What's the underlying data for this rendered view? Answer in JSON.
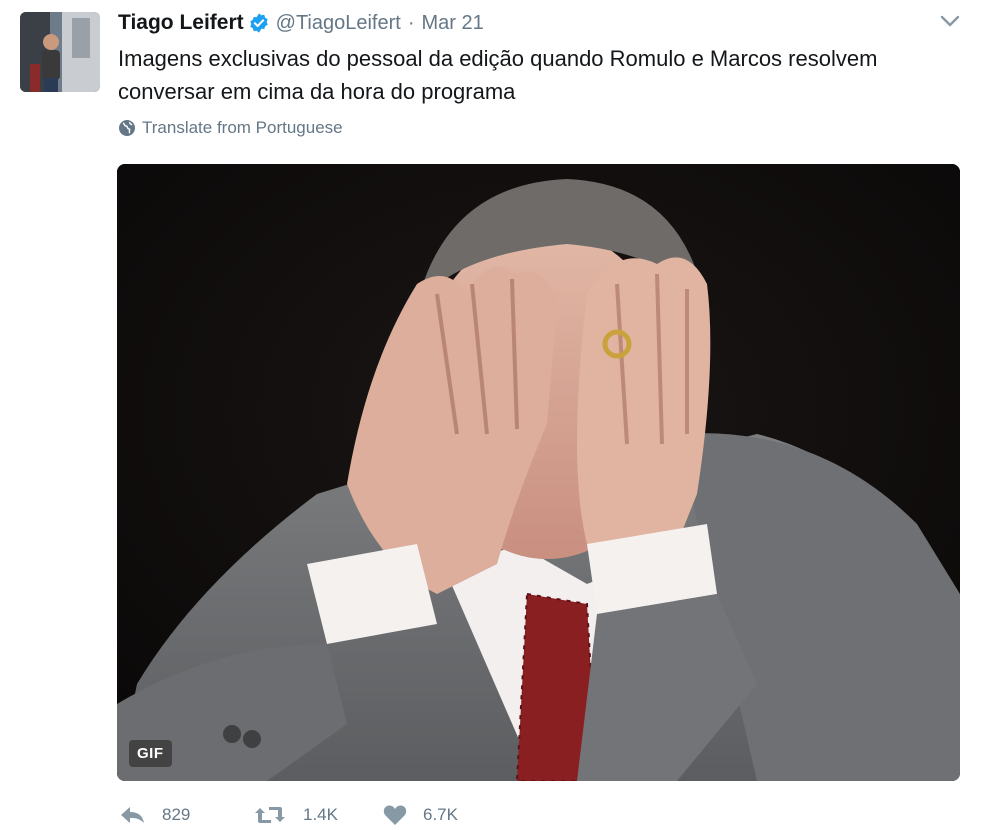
{
  "author": {
    "name": "Tiago Leifert",
    "handle": "@TiagoLeifert",
    "separator": "·",
    "date": "Mar 21"
  },
  "tweet": {
    "text": "Imagens exclusivas do pessoal da edição quando Romulo e Marcos resolvem conversar em cima da hora do programa",
    "translate_label": "Translate from Portuguese"
  },
  "media": {
    "badge": "GIF",
    "type": "animated-gif"
  },
  "actions": {
    "replies": "829",
    "retweets": "1.4K",
    "likes": "6.7K"
  },
  "icons": {
    "verified": "verified-badge-icon",
    "caret": "chevron-down-icon",
    "globe": "globe-icon",
    "reply": "reply-icon",
    "retweet": "retweet-icon",
    "like": "heart-icon"
  },
  "colors": {
    "verified_blue": "#1da1f2",
    "muted_text": "#657786",
    "primary_text": "#14171a"
  }
}
